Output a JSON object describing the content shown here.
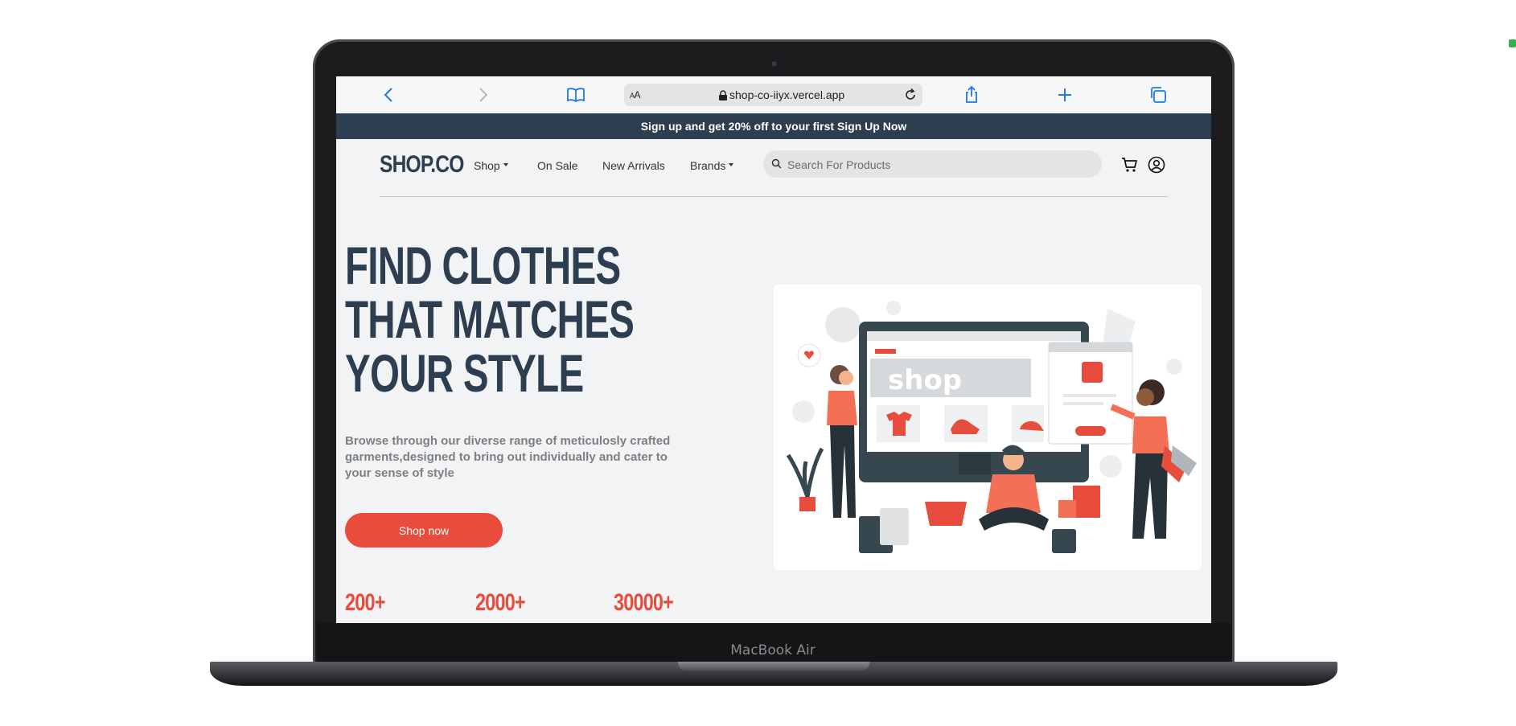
{
  "device": {
    "model_label": "MacBook Air"
  },
  "browser": {
    "url_text": "shop-co-iiyx.vercel.app",
    "text_size_label_big": "A",
    "text_size_label_small": "A"
  },
  "promo_banner": {
    "text": "Sign up and get 20% off to your first Sign Up Now"
  },
  "nav": {
    "logo": "SHOP.CO",
    "links": [
      {
        "label": "Shop",
        "has_dropdown": true
      },
      {
        "label": "On Sale",
        "has_dropdown": false
      },
      {
        "label": "New Arrivals",
        "has_dropdown": false
      },
      {
        "label": "Brands",
        "has_dropdown": true
      }
    ],
    "search_placeholder": "Search For Products"
  },
  "hero": {
    "title_lines": [
      "FIND CLOTHES",
      "THAT MATCHES",
      "YOUR STYLE"
    ],
    "description": "Browse through our diverse range of meticulosly crafted garments,designed to bring out individually and cater to your sense of style",
    "cta_label": "Shop now",
    "stats": [
      "200+",
      "2000+",
      "30000+"
    ],
    "illustration_text": "shop"
  },
  "colors": {
    "primary": "#2c3e50",
    "accent": "#e74c3c",
    "page_bg": "#f2f3f5",
    "safari_blue": "#1e7be6"
  },
  "icons": {
    "browser": [
      "back-icon",
      "forward-icon",
      "bookmarks-icon",
      "lock-icon",
      "reload-icon",
      "share-icon",
      "new-tab-icon",
      "tabs-icon"
    ],
    "nav": [
      "search-icon",
      "cart-icon",
      "user-icon"
    ]
  }
}
